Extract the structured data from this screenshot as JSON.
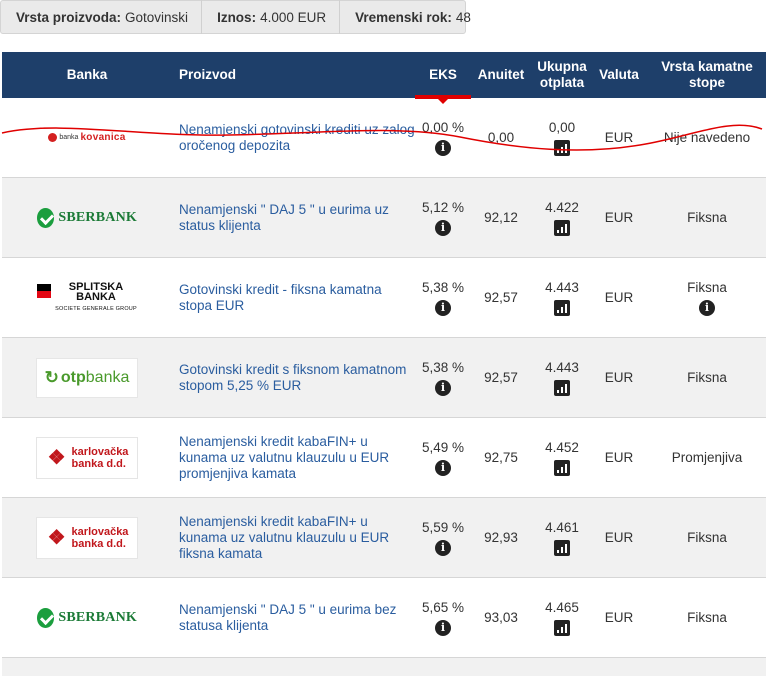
{
  "filters": {
    "product_type_label": "Vrsta proizvoda:",
    "product_type_value": "Gotovinski",
    "amount_label": "Iznos:",
    "amount_value": "4.000 EUR",
    "term_label": "Vremenski rok:",
    "term_value": "48"
  },
  "headers": {
    "bank": "Banka",
    "product": "Proizvod",
    "eks": "EKS",
    "annuity": "Anuitet",
    "total_1": "Ukupna",
    "total_2": "otplata",
    "currency": "Valuta",
    "rate_type_1": "Vrsta kamatne",
    "rate_type_2": "stope"
  },
  "rows": [
    {
      "bank": "banka kovanica",
      "logo_prefix": "banka",
      "logo_name": "kovanica",
      "product": "Nenamjenski gotovinski krediti uz zalog oročenog depozita",
      "eks": "0,00 %",
      "annuity": "0,00",
      "total": "0,00",
      "currency": "EUR",
      "rate_type": "Nije navedeno"
    },
    {
      "bank": "SBERBANK",
      "product": "Nenamjenski \" DAJ 5 \" u eurima uz status klijenta",
      "eks": "5,12 %",
      "annuity": "92,12",
      "total": "4.422",
      "currency": "EUR",
      "rate_type": "Fiksna"
    },
    {
      "bank": "SPLITSKA BANKA",
      "bank_line1": "SPLITSKA",
      "bank_line2": "BANKA",
      "bank_group": "SOCIETE GENERALE GROUP",
      "product": "Gotovinski kredit - fiksna kamatna stopa EUR",
      "eks": "5,38 %",
      "annuity": "92,57",
      "total": "4.443",
      "currency": "EUR",
      "rate_type": "Fiksna"
    },
    {
      "bank": "otpbanka",
      "bank_p1": "otp",
      "bank_p2": "banka",
      "product": "Gotovinski kredit s fiksnom kamatnom stopom 5,25 % EUR",
      "eks": "5,38 %",
      "annuity": "92,57",
      "total": "4.443",
      "currency": "EUR",
      "rate_type": "Fiksna"
    },
    {
      "bank": "karlovačka banka d.d.",
      "bank_line1": "karlovačka",
      "bank_line2": "banka d.d.",
      "product": "Nenamjenski kredit kabaFIN+ u kunama uz valutnu klauzulu u EUR promjenjiva kamata",
      "eks": "5,49 %",
      "annuity": "92,75",
      "total": "4.452",
      "currency": "EUR",
      "rate_type": "Promjenjiva"
    },
    {
      "bank": "karlovačka banka d.d.",
      "bank_line1": "karlovačka",
      "bank_line2": "banka d.d.",
      "product": "Nenamjenski kredit kabaFIN+ u kunama uz valutnu klauzulu u EUR fiksna kamata",
      "eks": "5,59 %",
      "annuity": "92,93",
      "total": "4.461",
      "currency": "EUR",
      "rate_type": "Fiksna"
    },
    {
      "bank": "SBERBANK",
      "product": "Nenamjenski \" DAJ 5 \" u eurima bez statusa klijenta",
      "eks": "5,65 %",
      "annuity": "93,03",
      "total": "4.465",
      "currency": "EUR",
      "rate_type": "Fiksna"
    }
  ],
  "icons": {
    "info": "info-icon",
    "chart": "bar-chart-icon"
  },
  "colors": {
    "header_bg": "#1e3f6a",
    "sort_accent": "#e00000",
    "link": "#2a5d9f",
    "annotation": "#e00000"
  }
}
